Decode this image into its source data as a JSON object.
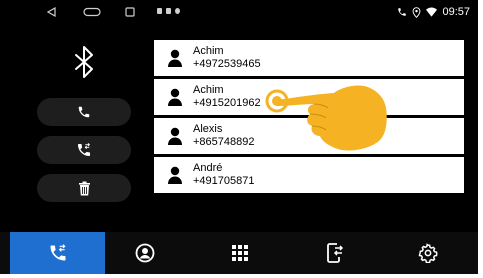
{
  "status_bar": {
    "nav_back": "back-triangle",
    "nav_home": "home-pill",
    "nav_recents": "recents-square",
    "time": "09:57"
  },
  "left_panel": {
    "bluetooth_icon": "bluetooth",
    "buttons": [
      {
        "icon": "phone-call"
      },
      {
        "icon": "phone-transfer"
      },
      {
        "icon": "trash"
      }
    ]
  },
  "contacts": [
    {
      "name": "Achim",
      "number": "+4972539465"
    },
    {
      "name": "Achim",
      "number": "+4915201962"
    },
    {
      "name": "Alexis",
      "number": "+865748892"
    },
    {
      "name": "André",
      "number": "+491705871"
    }
  ],
  "bottom_nav": [
    {
      "icon": "phone-transfer",
      "active": true
    },
    {
      "icon": "contacts-circle",
      "active": false
    },
    {
      "icon": "dialpad-grid",
      "active": false
    },
    {
      "icon": "phone-device-transfer",
      "active": false
    },
    {
      "icon": "settings-gear",
      "active": false
    }
  ],
  "colors": {
    "accent": "#1f6fd0",
    "background": "#000000",
    "button_bg": "#1e1e1e",
    "hand": "#f5b324"
  }
}
